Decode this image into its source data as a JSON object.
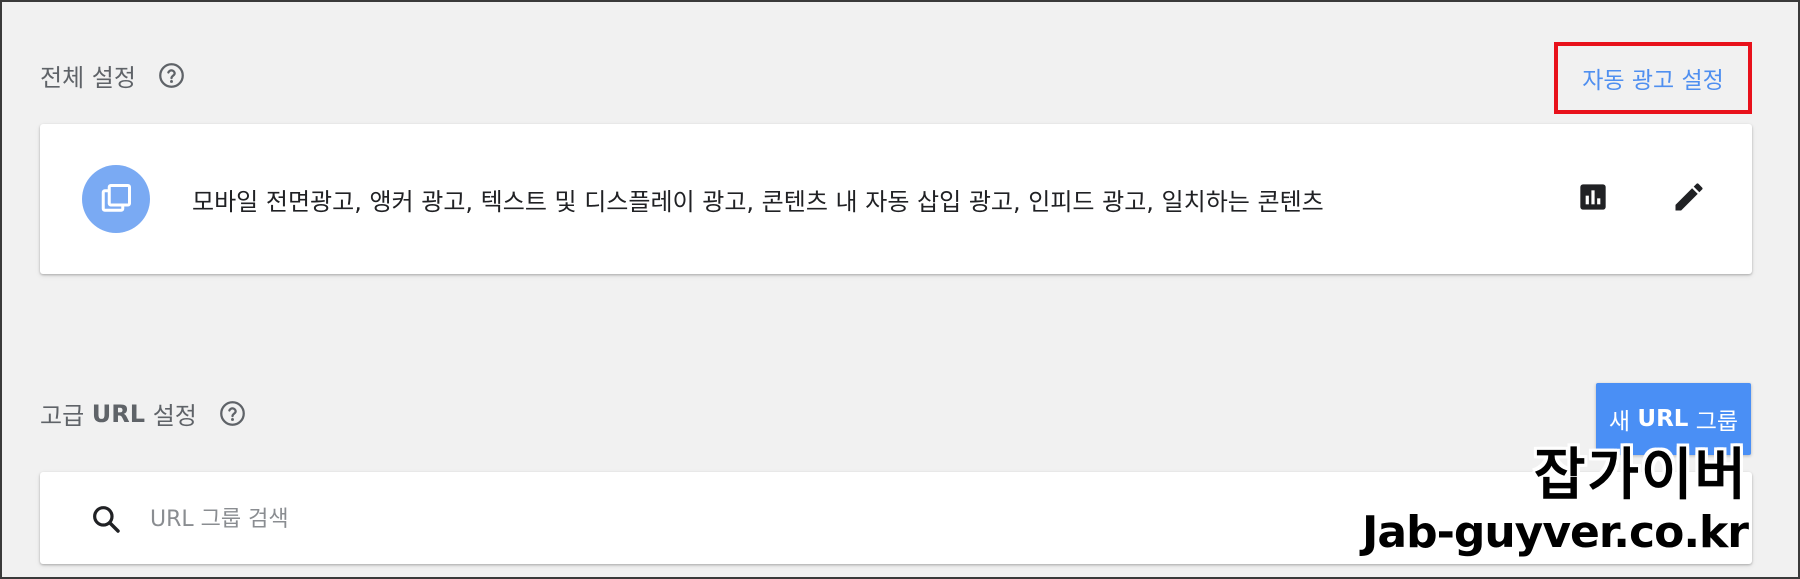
{
  "global_settings": {
    "title": "전체 설정",
    "auto_ads_link": "자동 광고 설정",
    "ad_description": "모바일 전면광고, 앵커 광고, 텍스트 및 디스플레이 광고, 콘텐츠 내 자동 삽입 광고, 인피드 광고, 일치하는 콘텐츠"
  },
  "advanced_url_settings": {
    "title_prefix": "고급 ",
    "title_bold": "URL",
    "title_suffix": " 설정",
    "new_button_prefix": "새 ",
    "new_button_bold": "URL",
    "new_button_suffix": " 그룹",
    "search_placeholder": "URL 그룹 검색"
  },
  "watermark": {
    "title": "잡가이버",
    "url": "Jab-guyver.co.kr"
  },
  "colors": {
    "link_blue": "#4f8ff0",
    "highlight_red": "#e8111b",
    "button_blue": "#4a8ff5",
    "avatar_blue": "#7aaaf3",
    "background": "#f1f1f1"
  },
  "icons": [
    "help-icon",
    "ad-layers-icon",
    "stats-icon",
    "edit-icon",
    "search-icon"
  ]
}
